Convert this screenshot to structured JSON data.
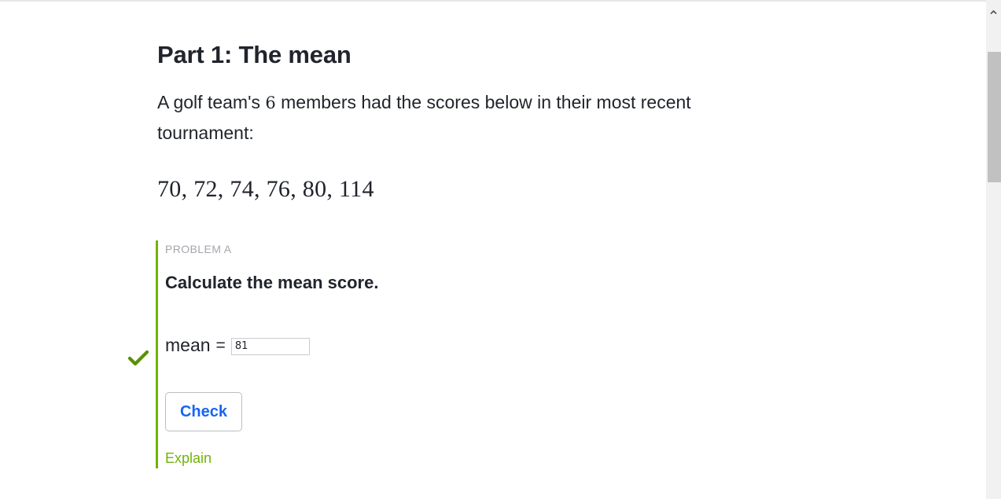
{
  "header": {
    "title": "Part 1: The mean"
  },
  "intro": {
    "text_before": "A golf team's ",
    "count": "6",
    "text_after": " members had the scores below in their most recent tournament:"
  },
  "scores": "70, 72, 74, 76, 80, 114",
  "problem": {
    "label": "PROBLEM A",
    "question": "Calculate the mean score.",
    "answer_label": "mean",
    "equals": "=",
    "answer_value": "81",
    "status": "correct",
    "check_button_label": "Check",
    "explain_label": "Explain"
  },
  "colors": {
    "accent_green": "#71b307",
    "check_green": "#5a8f00",
    "link_blue": "#1865f2",
    "text": "#21242c",
    "muted": "#a3a6ab"
  },
  "icons": {
    "status": "checkmark-icon",
    "scroll": "chevron-up-icon"
  }
}
